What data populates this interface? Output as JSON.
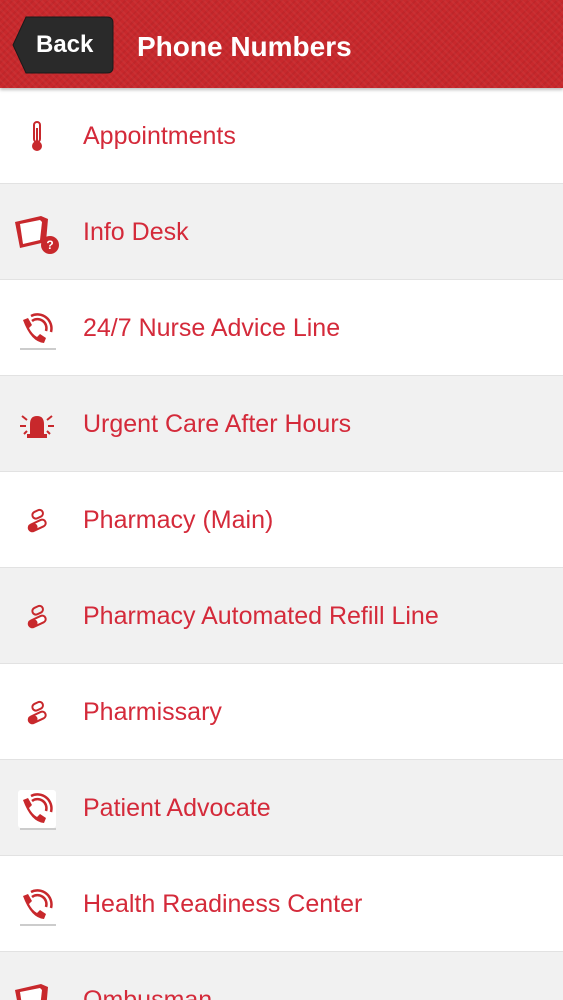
{
  "header": {
    "back_label": "Back",
    "title": "Phone Numbers"
  },
  "colors": {
    "header_bg": "#c8282c",
    "back_button_bg": "#2a2a2a",
    "item_text": "#d42a3a",
    "row_alt_bg": "#f1f1f1"
  },
  "items": [
    {
      "label": "Appointments",
      "icon": "thermometer-icon"
    },
    {
      "label": "Info Desk",
      "icon": "info-desk-icon"
    },
    {
      "label": "24/7 Nurse Advice Line",
      "icon": "phone-call-icon"
    },
    {
      "label": "Urgent Care After Hours",
      "icon": "siren-icon"
    },
    {
      "label": "Pharmacy (Main)",
      "icon": "pill-icon"
    },
    {
      "label": "Pharmacy Automated Refill Line",
      "icon": "pill-icon"
    },
    {
      "label": "Pharmissary",
      "icon": "pill-icon"
    },
    {
      "label": "Patient Advocate",
      "icon": "phone-call-icon"
    },
    {
      "label": "Health Readiness Center",
      "icon": "phone-call-icon"
    },
    {
      "label": "Ombusman",
      "icon": "info-desk-icon"
    }
  ]
}
